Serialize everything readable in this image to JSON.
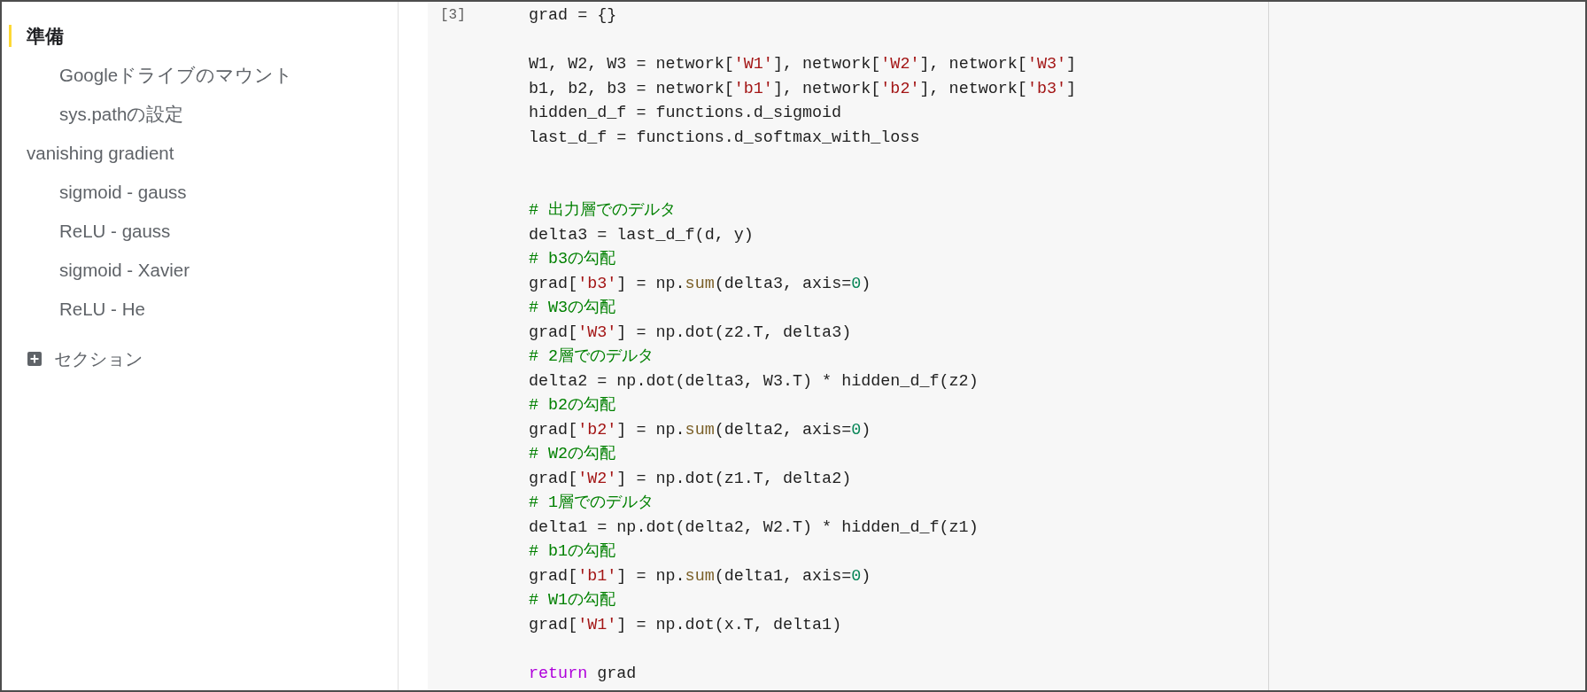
{
  "sidebar": {
    "items": [
      {
        "label": "準備",
        "selected": true,
        "children": [
          {
            "label": "Googleドライブのマウント",
            "selected": false
          },
          {
            "label": "sys.pathの設定",
            "selected": false
          }
        ]
      },
      {
        "label": "vanishing gradient",
        "selected": false,
        "children": [
          {
            "label": "sigmoid - gauss",
            "selected": false
          },
          {
            "label": "ReLU - gauss",
            "selected": false
          },
          {
            "label": "sigmoid - Xavier",
            "selected": false
          },
          {
            "label": "ReLU - He",
            "selected": false
          }
        ]
      }
    ],
    "add_section": {
      "label": "セクション"
    }
  },
  "cell": {
    "execution_count": "[3]",
    "lines": [
      {
        "kind": "code",
        "tokens": [
          {
            "kind": "plain",
            "text": "grad = {}"
          }
        ]
      },
      {
        "kind": "blank"
      },
      {
        "kind": "code",
        "tokens": [
          {
            "kind": "plain",
            "text": "W1, W2, W3 = network["
          },
          {
            "kind": "string",
            "text": "'W1'"
          },
          {
            "kind": "plain",
            "text": "], network["
          },
          {
            "kind": "string",
            "text": "'W2'"
          },
          {
            "kind": "plain",
            "text": "], network["
          },
          {
            "kind": "string",
            "text": "'W3'"
          },
          {
            "kind": "plain",
            "text": "]"
          }
        ]
      },
      {
        "kind": "code",
        "tokens": [
          {
            "kind": "plain",
            "text": "b1, b2, b3 = network["
          },
          {
            "kind": "string",
            "text": "'b1'"
          },
          {
            "kind": "plain",
            "text": "], network["
          },
          {
            "kind": "string",
            "text": "'b2'"
          },
          {
            "kind": "plain",
            "text": "], network["
          },
          {
            "kind": "string",
            "text": "'b3'"
          },
          {
            "kind": "plain",
            "text": "]"
          }
        ]
      },
      {
        "kind": "code",
        "tokens": [
          {
            "kind": "plain",
            "text": "hidden_d_f = functions.d_sigmoid"
          }
        ]
      },
      {
        "kind": "code",
        "tokens": [
          {
            "kind": "plain",
            "text": "last_d_f = functions.d_softmax_with_loss"
          }
        ]
      },
      {
        "kind": "blank"
      },
      {
        "kind": "blank"
      },
      {
        "kind": "code",
        "tokens": [
          {
            "kind": "comment",
            "text": "# 出力層でのデルタ"
          }
        ]
      },
      {
        "kind": "code",
        "tokens": [
          {
            "kind": "plain",
            "text": "delta3 = last_d_f(d, y)"
          }
        ]
      },
      {
        "kind": "code",
        "tokens": [
          {
            "kind": "comment",
            "text": "# b3の勾配"
          }
        ]
      },
      {
        "kind": "code",
        "tokens": [
          {
            "kind": "plain",
            "text": "grad["
          },
          {
            "kind": "string",
            "text": "'b3'"
          },
          {
            "kind": "plain",
            "text": "] = np."
          },
          {
            "kind": "builtin",
            "text": "sum"
          },
          {
            "kind": "plain",
            "text": "(delta3, axis="
          },
          {
            "kind": "number",
            "text": "0"
          },
          {
            "kind": "plain",
            "text": ")"
          }
        ]
      },
      {
        "kind": "code",
        "tokens": [
          {
            "kind": "comment",
            "text": "# W3の勾配"
          }
        ]
      },
      {
        "kind": "code",
        "tokens": [
          {
            "kind": "plain",
            "text": "grad["
          },
          {
            "kind": "string",
            "text": "'W3'"
          },
          {
            "kind": "plain",
            "text": "] = np.dot(z2.T, delta3)"
          }
        ]
      },
      {
        "kind": "code",
        "tokens": [
          {
            "kind": "comment",
            "text": "# 2層でのデルタ"
          }
        ]
      },
      {
        "kind": "code",
        "tokens": [
          {
            "kind": "plain",
            "text": "delta2 = np.dot(delta3, W3.T) * hidden_d_f(z2)"
          }
        ]
      },
      {
        "kind": "code",
        "tokens": [
          {
            "kind": "comment",
            "text": "# b2の勾配"
          }
        ]
      },
      {
        "kind": "code",
        "tokens": [
          {
            "kind": "plain",
            "text": "grad["
          },
          {
            "kind": "string",
            "text": "'b2'"
          },
          {
            "kind": "plain",
            "text": "] = np."
          },
          {
            "kind": "builtin",
            "text": "sum"
          },
          {
            "kind": "plain",
            "text": "(delta2, axis="
          },
          {
            "kind": "number",
            "text": "0"
          },
          {
            "kind": "plain",
            "text": ")"
          }
        ]
      },
      {
        "kind": "code",
        "tokens": [
          {
            "kind": "comment",
            "text": "# W2の勾配"
          }
        ]
      },
      {
        "kind": "code",
        "tokens": [
          {
            "kind": "plain",
            "text": "grad["
          },
          {
            "kind": "string",
            "text": "'W2'"
          },
          {
            "kind": "plain",
            "text": "] = np.dot(z1.T, delta2)"
          }
        ]
      },
      {
        "kind": "code",
        "tokens": [
          {
            "kind": "comment",
            "text": "# 1層でのデルタ"
          }
        ]
      },
      {
        "kind": "code",
        "tokens": [
          {
            "kind": "plain",
            "text": "delta1 = np.dot(delta2, W2.T) * hidden_d_f(z1)"
          }
        ]
      },
      {
        "kind": "code",
        "tokens": [
          {
            "kind": "comment",
            "text": "# b1の勾配"
          }
        ]
      },
      {
        "kind": "code",
        "tokens": [
          {
            "kind": "plain",
            "text": "grad["
          },
          {
            "kind": "string",
            "text": "'b1'"
          },
          {
            "kind": "plain",
            "text": "] = np."
          },
          {
            "kind": "builtin",
            "text": "sum"
          },
          {
            "kind": "plain",
            "text": "(delta1, axis="
          },
          {
            "kind": "number",
            "text": "0"
          },
          {
            "kind": "plain",
            "text": ")"
          }
        ]
      },
      {
        "kind": "code",
        "tokens": [
          {
            "kind": "comment",
            "text": "# W1の勾配"
          }
        ]
      },
      {
        "kind": "code",
        "tokens": [
          {
            "kind": "plain",
            "text": "grad["
          },
          {
            "kind": "string",
            "text": "'W1'"
          },
          {
            "kind": "plain",
            "text": "] = np.dot(x.T, delta1)"
          }
        ]
      },
      {
        "kind": "blank"
      },
      {
        "kind": "code",
        "tokens": [
          {
            "kind": "keyword",
            "text": "return"
          },
          {
            "kind": "plain",
            "text": " grad"
          }
        ]
      }
    ]
  }
}
